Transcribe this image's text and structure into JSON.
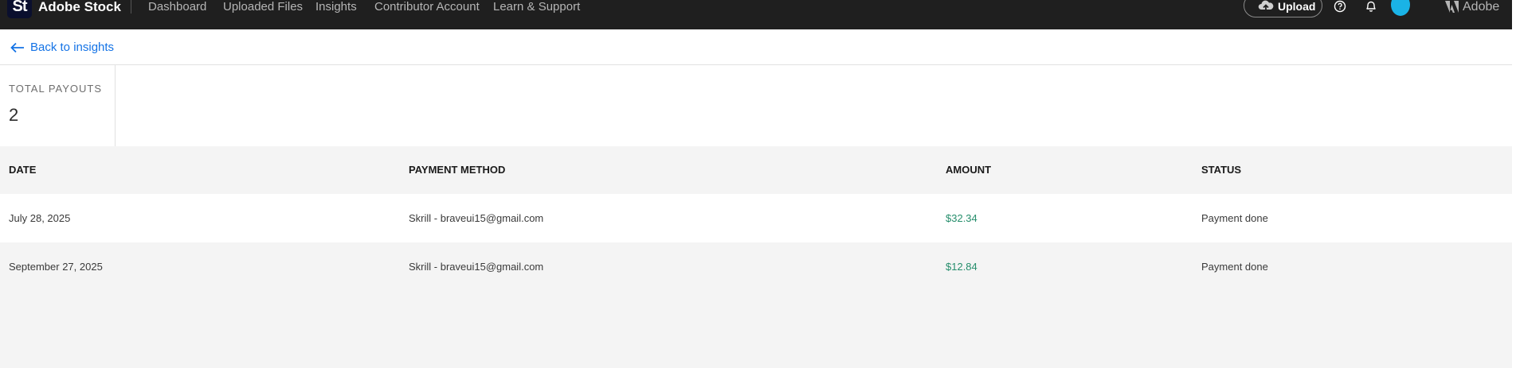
{
  "app": {
    "logo_text": "St",
    "brand": "Adobe Stock"
  },
  "nav": {
    "items": [
      "Dashboard",
      "Uploaded Files",
      "Insights",
      "Contributor Account",
      "Learn & Support"
    ]
  },
  "header_actions": {
    "upload_label": "Upload",
    "adobe_label": "Adobe",
    "icons": [
      "upload-cloud-icon",
      "help-icon",
      "bell-icon",
      "avatar",
      "adobe-logo-icon"
    ]
  },
  "back": {
    "label": "Back to insights"
  },
  "summary": {
    "label": "TOTAL PAYOUTS",
    "value": "2"
  },
  "table": {
    "columns": [
      "DATE",
      "PAYMENT METHOD",
      "AMOUNT",
      "STATUS"
    ],
    "rows": [
      {
        "date": "July 28, 2025",
        "method": "Skrill - braveui15@gmail.com",
        "amount": "$32.34",
        "status": "Payment done"
      },
      {
        "date": "September 27, 2025",
        "method": "Skrill - braveui15@gmail.com",
        "amount": "$12.84",
        "status": "Payment done"
      }
    ]
  },
  "colors": {
    "topbar": "#1f1f1f",
    "link": "#1473e6",
    "amount": "#268e6c",
    "avatar": "#1ab3e6"
  }
}
